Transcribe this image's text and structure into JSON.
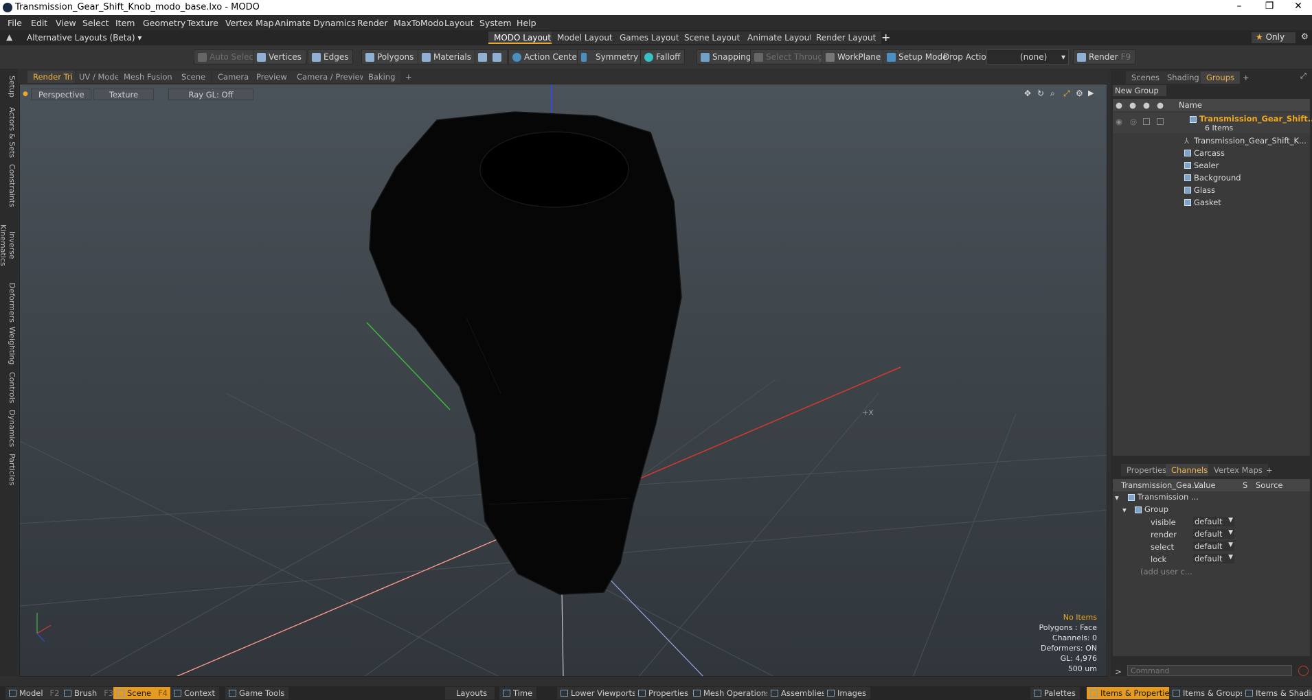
{
  "window": {
    "title": "Transmission_Gear_Shift_Knob_modo_base.lxo - MODO",
    "minimize": "–",
    "restore": "❐",
    "close": "✕"
  },
  "menu": [
    "File",
    "Edit",
    "View",
    "Select",
    "Item",
    "Geometry",
    "Texture",
    "Vertex Map",
    "Animate",
    "Dynamics",
    "Render",
    "MaxToModo",
    "Layout",
    "System",
    "Help"
  ],
  "layouts": {
    "alt_layouts": "Alternative Layouts (Beta)",
    "tabs": [
      "MODO Layout",
      "Model Layout",
      "Games Layout",
      "Scene Layout",
      "Animate Layout",
      "Render Layout"
    ],
    "add": "+",
    "only": "Only"
  },
  "toolbar": {
    "auto_select": "Auto Select",
    "vertices": "Vertices",
    "edges": "Edges",
    "polygons": "Polygons",
    "materials": "Materials",
    "action_center": "Action Center",
    "symmetry": "Symmetry",
    "falloff": "Falloff",
    "snapping": "Snapping",
    "select_through": "Select Through",
    "workplane": "WorkPlane",
    "setup_mode": "Setup Mode",
    "drop_action": "Drop Action",
    "drop_value": "(none)",
    "render": "Render",
    "render_key": "F9"
  },
  "left_tabs": [
    "Setup",
    "Actors & Sets",
    "Constraints",
    "Inverse Kinematics",
    "Deformers",
    "Weighting",
    "Controls",
    "Dynamics",
    "Particles"
  ],
  "viewport_tabs": [
    "Render Tri",
    "UV / Model",
    "Mesh Fusion",
    "Scene",
    "Camera",
    "Preview",
    "Camera / Preview",
    "Baking",
    "+"
  ],
  "viewport": {
    "perspective": "Perspective",
    "texture": "Texture",
    "raygl": "Ray GL: Off",
    "axis_x": "+X"
  },
  "info": {
    "items": "No Items",
    "polygons": "Polygons : Face",
    "channels": "Channels: 0",
    "deformers": "Deformers: ON",
    "gl": "GL: 4,976",
    "scale": "500 um"
  },
  "colors": {
    "accent": "#f0b247",
    "items_label": "#f0a81c",
    "x_axis": "#d63a2e",
    "y_axis": "#3fb83f",
    "z_axis": "#3b49d8"
  },
  "right_top": {
    "tabs": [
      "Scenes",
      "Shading",
      "Groups",
      "+"
    ],
    "new_group": "New Group",
    "name_col": "Name",
    "group_name": "Transmission_Gear_Shift...",
    "items_count": "6 Items",
    "items": [
      "Transmission_Gear_Shift_K...",
      "Carcass",
      "Sealer",
      "Background",
      "Glass",
      "Gasket"
    ]
  },
  "right_bottom": {
    "tabs": [
      "Properties",
      "Channels",
      "Vertex Maps",
      "+"
    ],
    "cols": [
      "Transmission_Gea...",
      "Value",
      "S",
      "Source"
    ],
    "root": "Transmission ...",
    "group": "Group",
    "channels": [
      {
        "name": "visible",
        "value": "default"
      },
      {
        "name": "render",
        "value": "default"
      },
      {
        "name": "select",
        "value": "default"
      },
      {
        "name": "lock",
        "value": "default"
      }
    ],
    "add_user": "(add user c..."
  },
  "command": {
    "prompt": ">",
    "placeholder": "Command"
  },
  "bottom": {
    "model": "Model",
    "model_key": "F2",
    "brush": "Brush",
    "brush_key": "F3",
    "scene": "Scene",
    "scene_key": "F4",
    "context": "Context",
    "game_tools": "Game Tools",
    "layouts": "Layouts",
    "time": "Time",
    "lower_viewports": "Lower Viewports",
    "properties": "Properties",
    "mesh_operations": "Mesh Operations",
    "assemblies": "Assemblies",
    "images": "Images",
    "palettes": "Palettes",
    "items_properties": "Items & Properties",
    "items_groups": "Items & Groups",
    "items_shading": "Items & Shading"
  }
}
